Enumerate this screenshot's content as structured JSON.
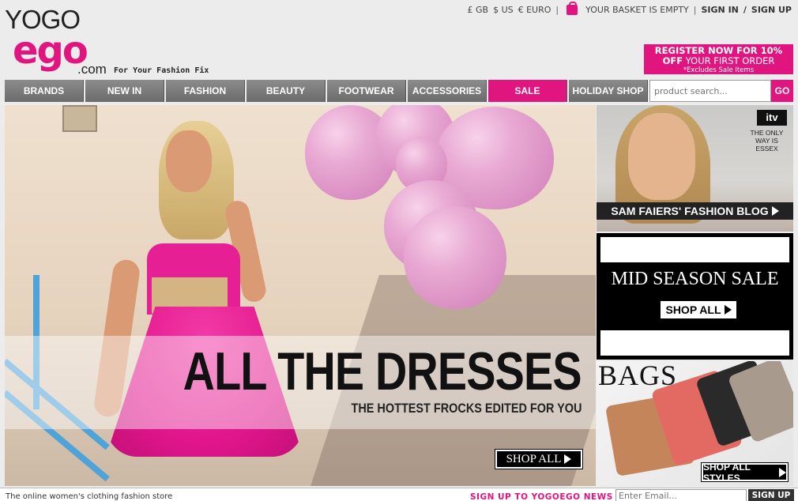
{
  "brand": {
    "top": "YOGO",
    "main": "ego",
    "suffix": ".com",
    "tagline": "For Your Fashion Fix",
    "color": "#e0157f"
  },
  "topbar": {
    "currencies": [
      "£ GB",
      "$ US",
      "€ EURO"
    ],
    "separator": "|",
    "basket_icon": "shopping-bag-icon",
    "basket_text": "YOUR BASKET IS EMPTY",
    "sign_in": "SIGN IN",
    "slash": "/",
    "sign_up": "SIGN UP"
  },
  "promo": {
    "line1": "REGISTER NOW FOR 10%",
    "line2_bold": "OFF",
    "line2_rest": " YOUR FIRST ORDER",
    "line3": "*Excludes Sale Items"
  },
  "nav": {
    "items": [
      "BRANDS",
      "NEW IN",
      "FASHION",
      "BEAUTY",
      "FOOTWEAR",
      "ACCESSORIES",
      "SALE",
      "HOLIDAY SHOP"
    ]
  },
  "search": {
    "placeholder": "product search...",
    "button": "GO"
  },
  "hero": {
    "headline": "ALL THE DRESSES",
    "subheadline": "THE HOTTEST FROCKS EDITED FOR YOU",
    "cta": "SHOP ALL"
  },
  "side": {
    "blog": {
      "network": "itv",
      "show": "THE ONLY WAY IS ESSEX",
      "cta": "SAM FAIERS' FASHION BLOG"
    },
    "sale": {
      "title": "MID SEASON SALE",
      "cta": "SHOP ALL"
    },
    "bags": {
      "title": "BAGS",
      "cta": "SHOP ALL STYLES"
    }
  },
  "footer": {
    "tagline": "The online women's clothing fashion store",
    "signup_label": "SIGN UP TO YOGOEGO NEWS",
    "email_placeholder": "Enter Email...",
    "signup_button": "SIGN UP"
  }
}
